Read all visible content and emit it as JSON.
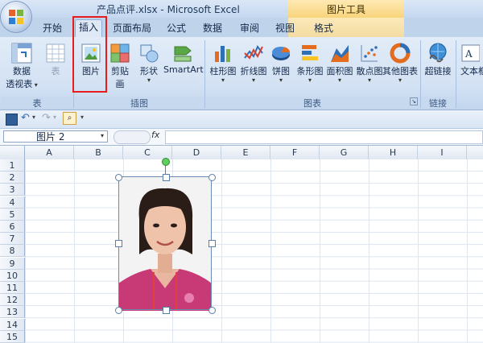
{
  "window": {
    "title": "产品点评.xlsx - Microsoft Excel",
    "tool_context": "图片工具"
  },
  "tabs": [
    "开始",
    "插入",
    "页面布局",
    "公式",
    "数据",
    "审阅",
    "视图",
    "格式"
  ],
  "ribbon": {
    "groups": {
      "table": "表",
      "illustrations": "插图",
      "charts": "图表",
      "links": "链接"
    },
    "buttons": {
      "pivot_line1": "数据",
      "pivot_line2": "透视表",
      "table": "表",
      "picture": "图片",
      "clipart": "剪贴画",
      "shapes": "形状",
      "smartart": "SmartArt",
      "column": "柱形图",
      "line": "折线图",
      "pie": "饼图",
      "bar": "条形图",
      "area": "面积图",
      "scatter": "散点图",
      "other": "其他图表",
      "hyperlink": "超链接",
      "textbox": "文本框"
    }
  },
  "formula_bar": {
    "name_box": "图片 2",
    "fx_label": "fx",
    "formula": ""
  },
  "columns": [
    "A",
    "B",
    "C",
    "D",
    "E",
    "F",
    "G",
    "H",
    "I"
  ],
  "rows": [
    "1",
    "2",
    "3",
    "4",
    "5",
    "6",
    "7",
    "8",
    "9",
    "10",
    "11",
    "12",
    "13",
    "14",
    "15"
  ],
  "colors": {
    "accent_red": "#e51d1d",
    "ribbon_blue": "#d2e1f3",
    "tool_yellow": "#f8d47c"
  }
}
